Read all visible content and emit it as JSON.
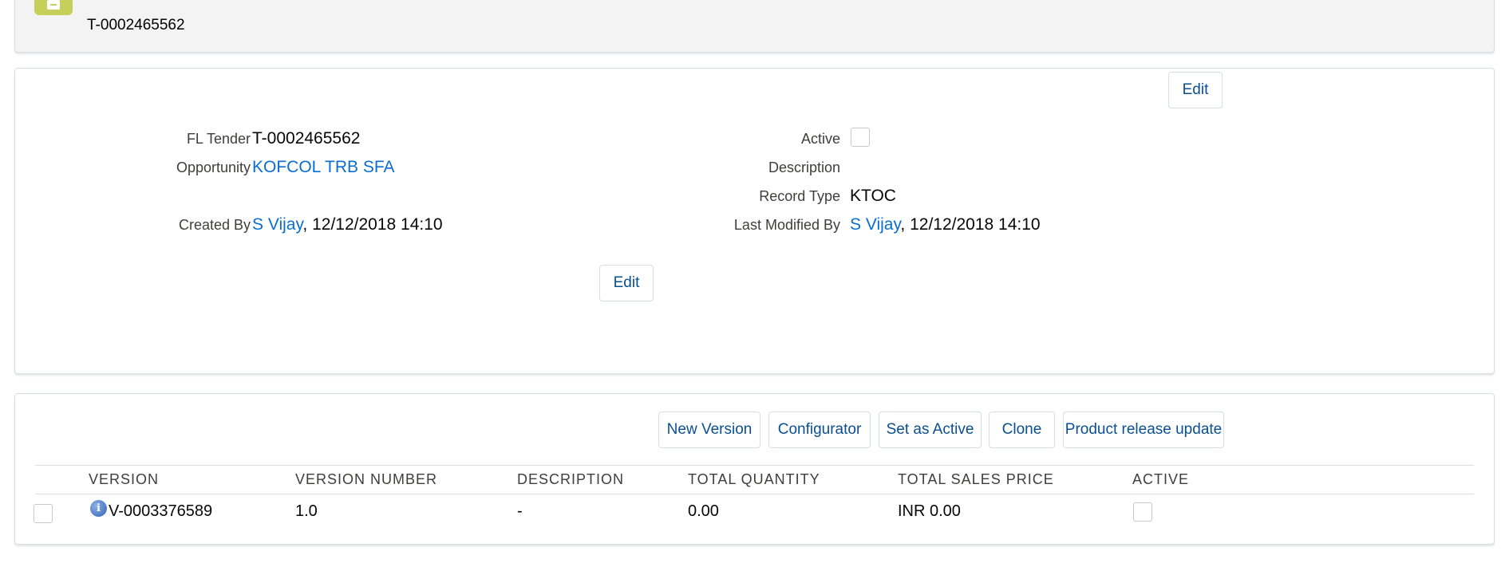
{
  "header": {
    "record_name": "T-0002465562",
    "icon": "record-icon"
  },
  "detail": {
    "edit_top_label": "Edit",
    "edit_bottom_label": "Edit",
    "fields": {
      "fl_tender_label": "FL Tender",
      "fl_tender_value": "T-0002465562",
      "opportunity_label": "Opportunity",
      "opportunity_value": "KOFCOL TRB SFA",
      "created_by_label": "Created By",
      "created_by_user": "S Vijay",
      "created_by_date": ", 12/12/2018 14:10",
      "active_label": "Active",
      "active_checked": false,
      "description_label": "Description",
      "description_value": "",
      "record_type_label": "Record Type",
      "record_type_value": "KTOC",
      "last_modified_by_label": "Last Modified By",
      "last_modified_by_user": "S Vijay",
      "last_modified_by_date": ", 12/12/2018 14:10"
    }
  },
  "versions": {
    "buttons": {
      "new_version": "New Version",
      "configurator": "Configurator",
      "set_as_active": "Set as Active",
      "clone": "Clone",
      "product_release_update": "Product release update"
    },
    "columns": {
      "version": "VERSION",
      "version_number": "VERSION NUMBER",
      "description": "DESCRIPTION",
      "total_quantity": "TOTAL QUANTITY",
      "total_sales_price": "TOTAL SALES PRICE",
      "active": "ACTIVE"
    },
    "rows": [
      {
        "version": "V-0003376589",
        "version_number": "1.0",
        "description": "-",
        "total_quantity": "0.00",
        "total_sales_price": "INR 0.00",
        "active": false
      }
    ]
  }
}
